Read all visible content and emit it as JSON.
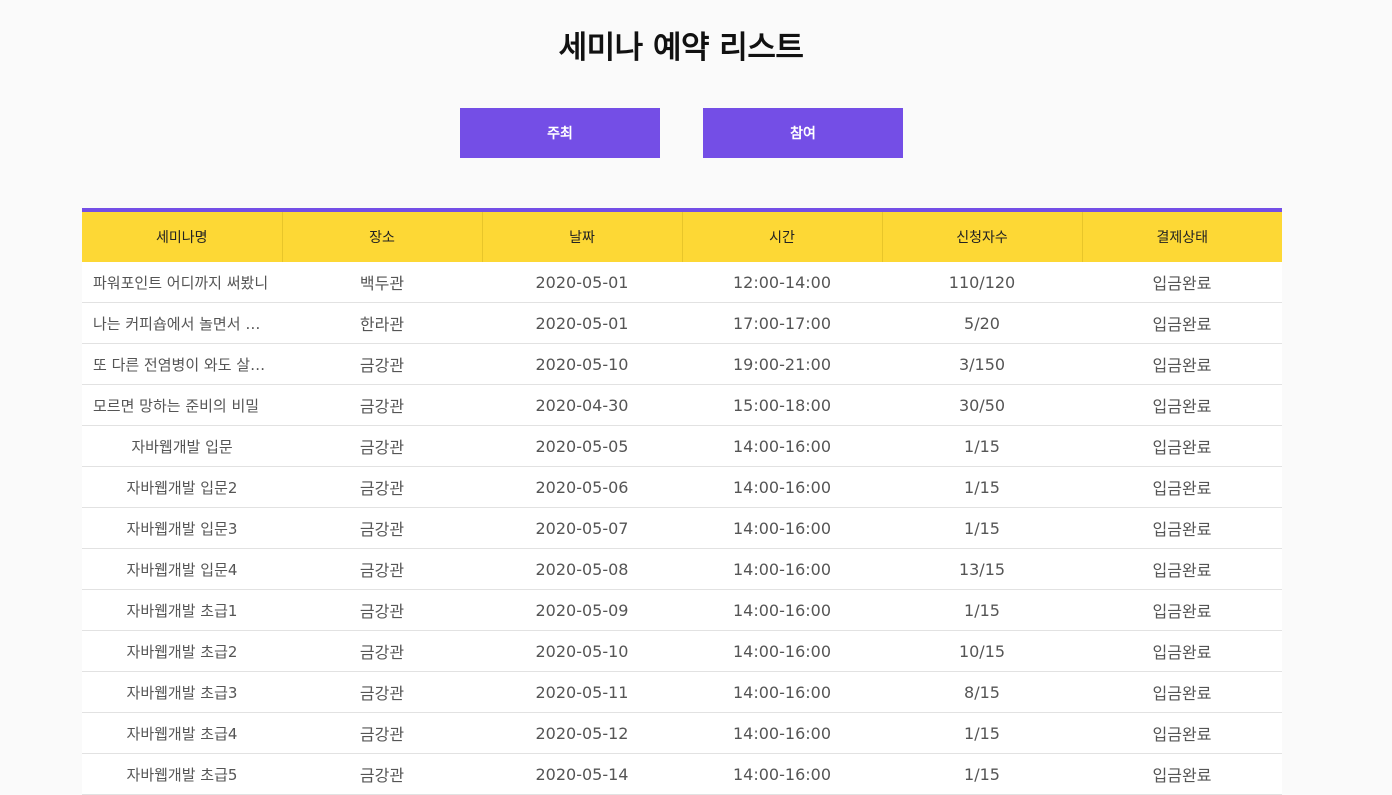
{
  "page": {
    "title": "세미나 예약 리스트"
  },
  "tabs": {
    "host_label": "주최",
    "join_label": "참여"
  },
  "colors": {
    "accent": "#744ee6",
    "header_bg": "#fdd835",
    "background": "#fafafa"
  },
  "table": {
    "columns": [
      "세미나명",
      "장소",
      "날짜",
      "시간",
      "신청자수",
      "결제상태"
    ],
    "rows": [
      {
        "name": "파워포인트 어디까지 써봤니",
        "place": "백두관",
        "date": "2020-05-01",
        "time": "12:00-14:00",
        "applicants": "110/120",
        "payment": "입금완료",
        "truncated": true
      },
      {
        "name": "나는 커피숍에서 놀면서 돈번다",
        "place": "한라관",
        "date": "2020-05-01",
        "time": "17:00-17:00",
        "applicants": "5/20",
        "payment": "입금완료",
        "truncated": true
      },
      {
        "name": "또 다른 전염병이 와도 살아남기",
        "place": "금강관",
        "date": "2020-05-10",
        "time": "19:00-21:00",
        "applicants": "3/150",
        "payment": "입금완료",
        "truncated": true
      },
      {
        "name": "모르면 망하는 준비의 비밀",
        "place": "금강관",
        "date": "2020-04-30",
        "time": "15:00-18:00",
        "applicants": "30/50",
        "payment": "입금완료",
        "truncated": true
      },
      {
        "name": "자바웹개발 입문",
        "place": "금강관",
        "date": "2020-05-05",
        "time": "14:00-16:00",
        "applicants": "1/15",
        "payment": "입금완료",
        "truncated": false
      },
      {
        "name": "자바웹개발 입문2",
        "place": "금강관",
        "date": "2020-05-06",
        "time": "14:00-16:00",
        "applicants": "1/15",
        "payment": "입금완료",
        "truncated": false
      },
      {
        "name": "자바웹개발 입문3",
        "place": "금강관",
        "date": "2020-05-07",
        "time": "14:00-16:00",
        "applicants": "1/15",
        "payment": "입금완료",
        "truncated": false
      },
      {
        "name": "자바웹개발 입문4",
        "place": "금강관",
        "date": "2020-05-08",
        "time": "14:00-16:00",
        "applicants": "13/15",
        "payment": "입금완료",
        "truncated": false
      },
      {
        "name": "자바웹개발 초급1",
        "place": "금강관",
        "date": "2020-05-09",
        "time": "14:00-16:00",
        "applicants": "1/15",
        "payment": "입금완료",
        "truncated": false
      },
      {
        "name": "자바웹개발 초급2",
        "place": "금강관",
        "date": "2020-05-10",
        "time": "14:00-16:00",
        "applicants": "10/15",
        "payment": "입금완료",
        "truncated": false
      },
      {
        "name": "자바웹개발 초급3",
        "place": "금강관",
        "date": "2020-05-11",
        "time": "14:00-16:00",
        "applicants": "8/15",
        "payment": "입금완료",
        "truncated": false
      },
      {
        "name": "자바웹개발 초급4",
        "place": "금강관",
        "date": "2020-05-12",
        "time": "14:00-16:00",
        "applicants": "1/15",
        "payment": "입금완료",
        "truncated": false
      },
      {
        "name": "자바웹개발 초급5",
        "place": "금강관",
        "date": "2020-05-14",
        "time": "14:00-16:00",
        "applicants": "1/15",
        "payment": "입금완료",
        "truncated": false
      }
    ]
  }
}
